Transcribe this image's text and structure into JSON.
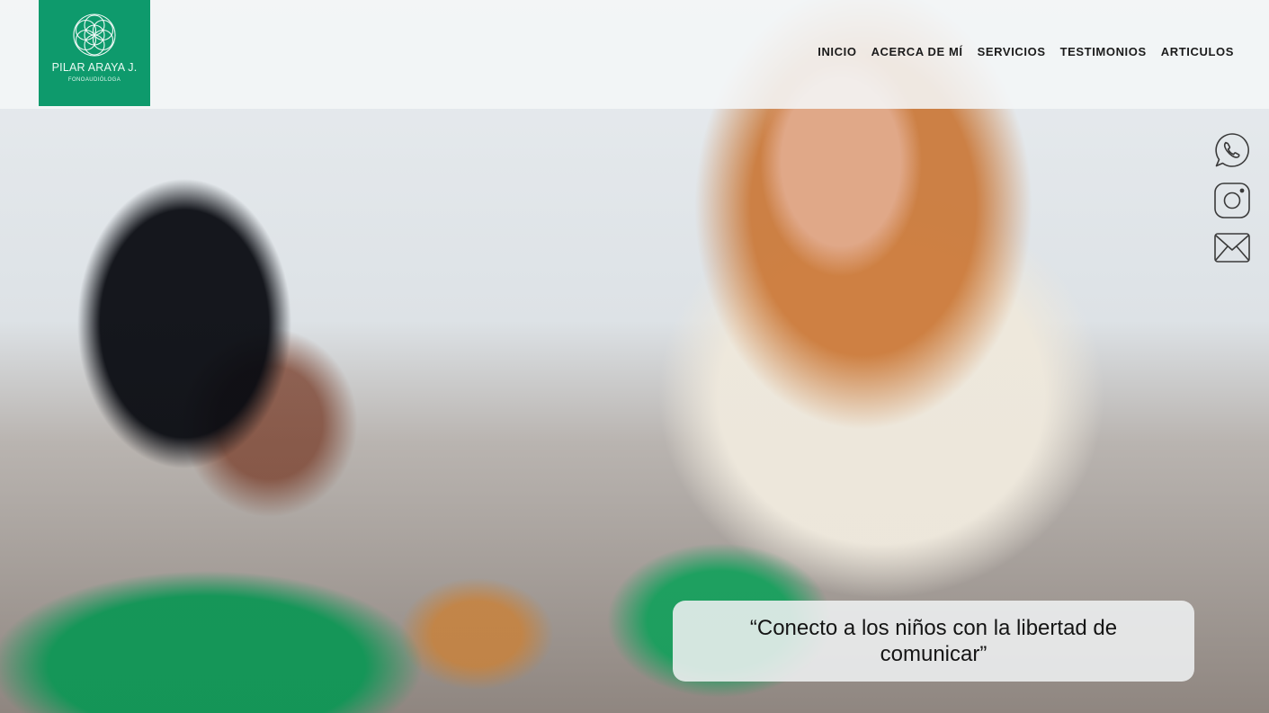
{
  "logo": {
    "name": "PILAR ARAYA J.",
    "subtitle": "FONOAUDIÓLOGA",
    "background": "#0e9a6c",
    "icon": "flower-of-life-icon"
  },
  "nav": {
    "items": [
      {
        "label": "INICIO"
      },
      {
        "label": "ACERCA DE MÍ"
      },
      {
        "label": "SERVICIOS"
      },
      {
        "label": "TESTIMONIOS"
      },
      {
        "label": "ARTICULOS"
      }
    ]
  },
  "social": [
    {
      "icon": "whatsapp-icon"
    },
    {
      "icon": "instagram-icon"
    },
    {
      "icon": "email-icon"
    }
  ],
  "hero": {
    "quote": "“Conecto a los niños con la libertad de comunicar”"
  }
}
